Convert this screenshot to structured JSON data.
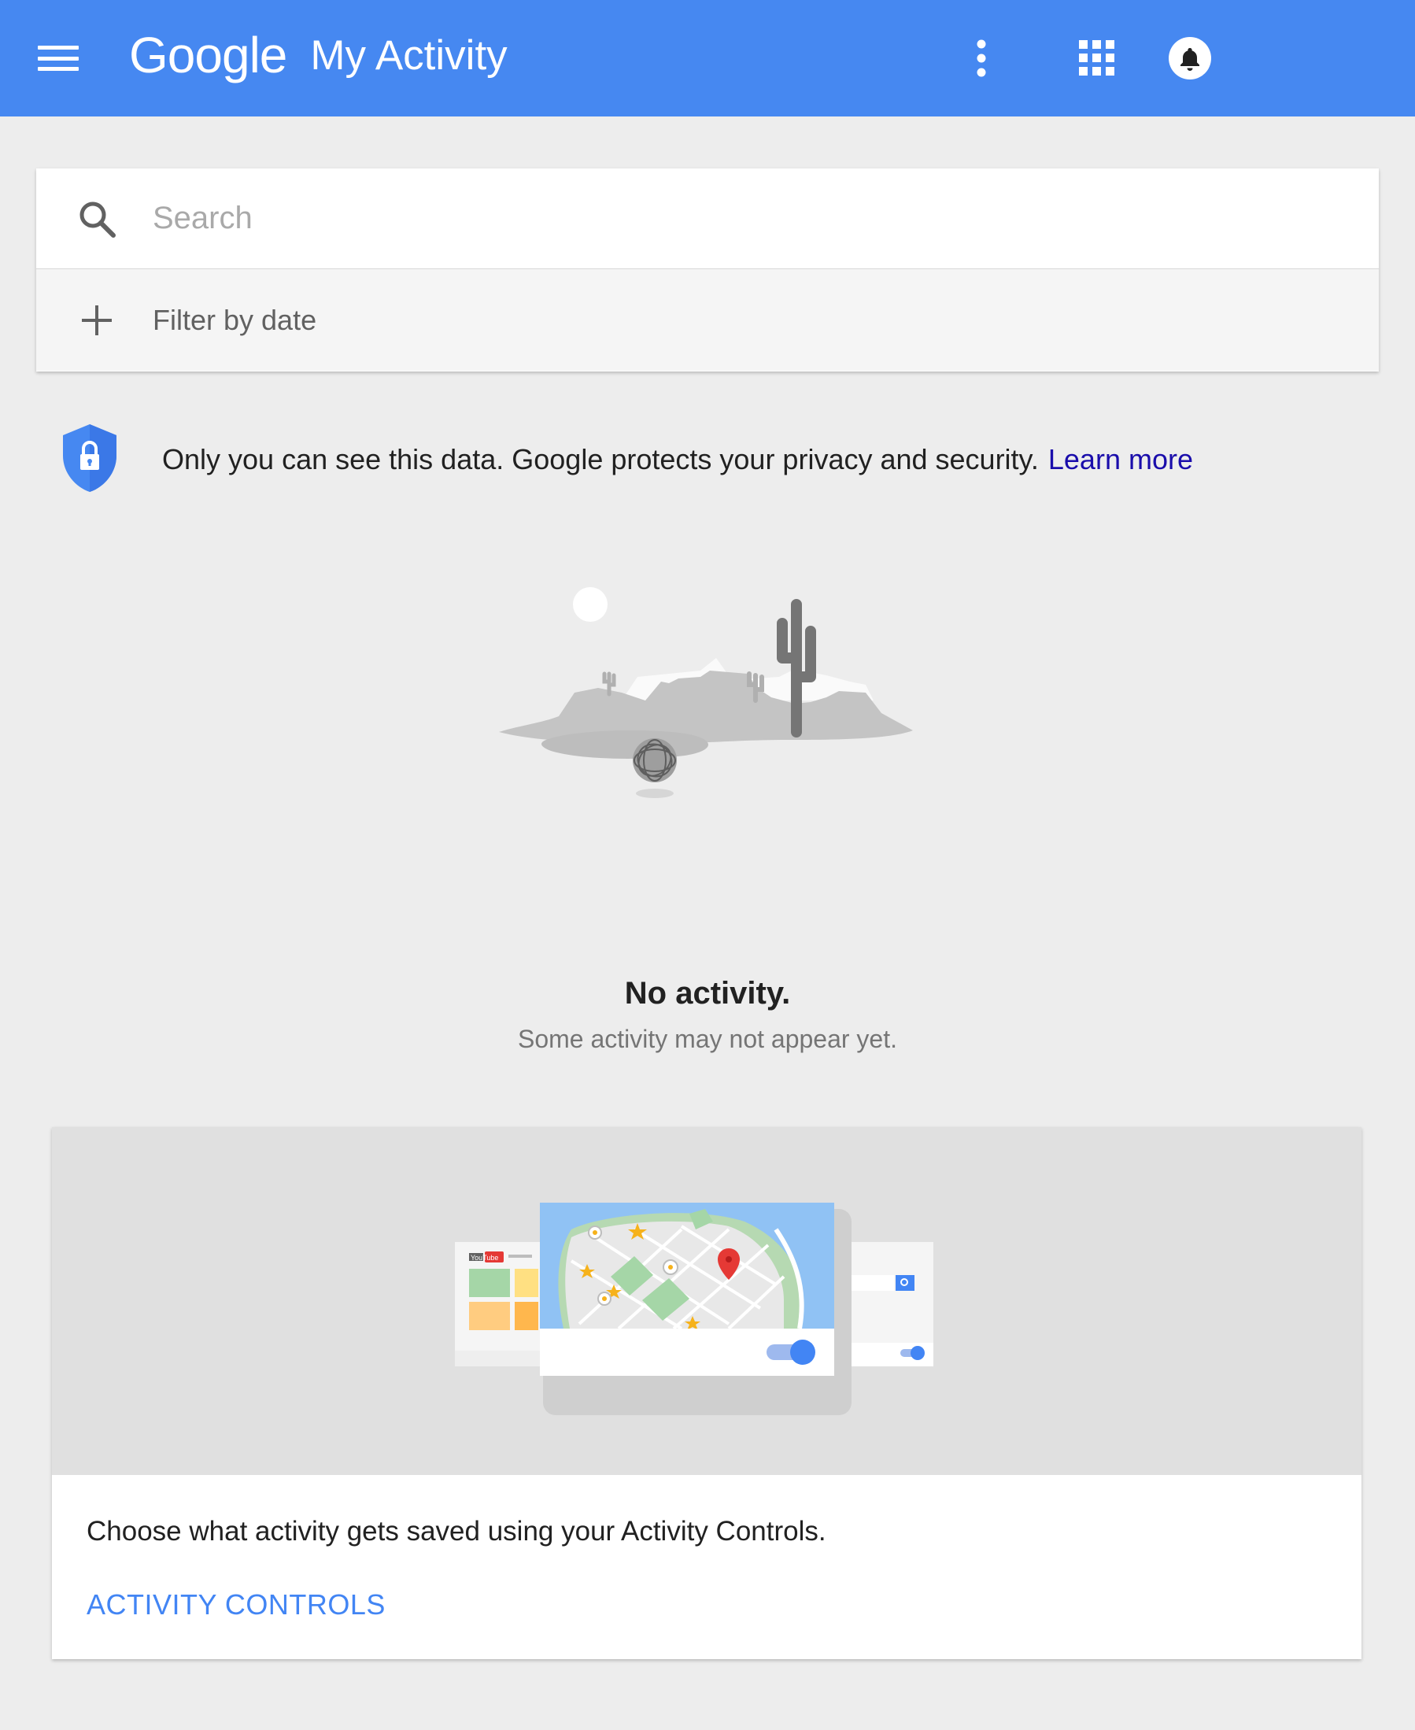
{
  "header": {
    "logo_text": "Google",
    "title": "My Activity",
    "icons": [
      "menu-icon",
      "more-vert-icon",
      "apps-grid-icon",
      "notifications-icon"
    ],
    "color": "#4688f1"
  },
  "search": {
    "placeholder": "Search",
    "value": "",
    "filter_label": "Filter by date"
  },
  "privacy": {
    "text": "Only you can see this data. Google protects your privacy and security.",
    "link": "Learn more",
    "link_color": "#1a0dab"
  },
  "empty_state": {
    "title": "No activity.",
    "subtitle": "Some activity may not appear yet."
  },
  "activity_controls": {
    "description": "Choose what activity gets saved using your Activity Controls.",
    "button": "ACTIVITY CONTROLS",
    "illustration_label": "YouTube"
  }
}
